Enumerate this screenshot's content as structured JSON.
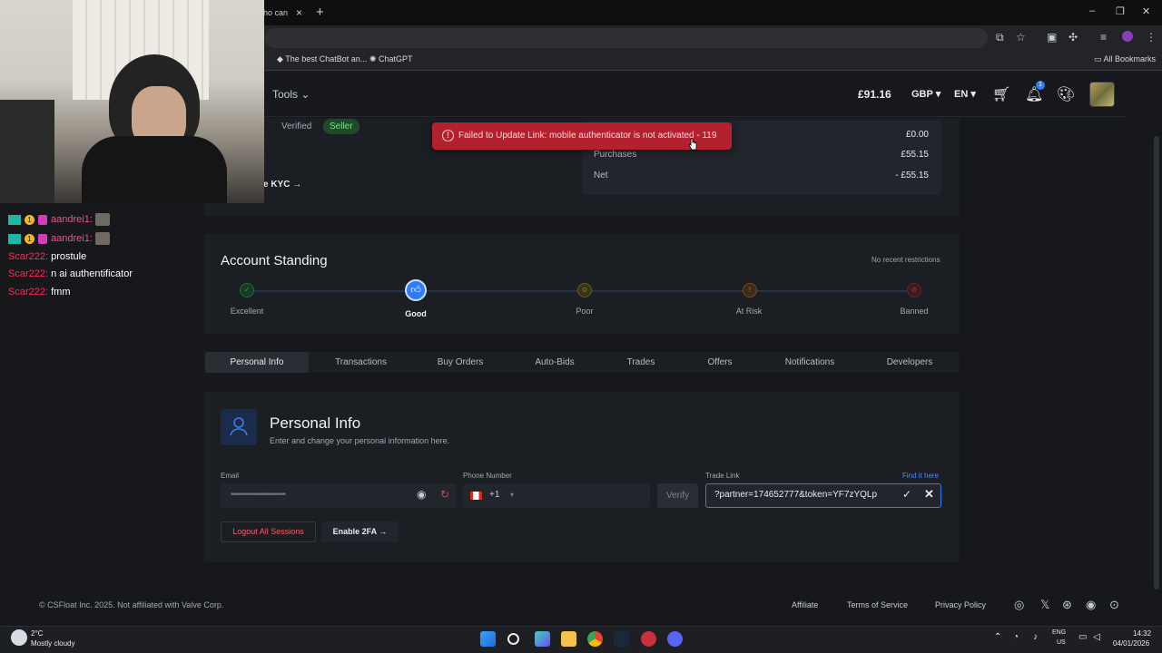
{
  "browser": {
    "tab_title": "ho can",
    "tab_close": "×",
    "new_tab": "+",
    "bookmarks": [
      "The best ChatBot an...",
      "ChatGPT"
    ],
    "all_bookmarks": "All Bookmarks",
    "window_controls": [
      "–",
      "❐",
      "✕"
    ]
  },
  "header": {
    "tools": "Tools",
    "balance": "£91.16",
    "currency": "GBP",
    "language": "EN",
    "notification_count": "1"
  },
  "top": {
    "verified": "Verified",
    "seller": "Seller",
    "kyc": "e KYC",
    "stats": [
      {
        "label": "",
        "value": "£0.00"
      },
      {
        "label": "Purchases",
        "value": "£55.15"
      },
      {
        "label": "Net",
        "value": "- £55.15"
      }
    ]
  },
  "toast": {
    "message": "Failed to Update Link: mobile authenticator is not activated - 119",
    "color": "#b3202e"
  },
  "standing": {
    "title": "Account Standing",
    "note": "No recent restrictions",
    "levels": [
      "Excellent",
      "Good",
      "Poor",
      "At Risk",
      "Banned"
    ],
    "current": "Good"
  },
  "tabs": [
    "Personal Info",
    "Transactions",
    "Buy Orders",
    "Auto-Bids",
    "Trades",
    "Offers",
    "Notifications",
    "Developers"
  ],
  "personal_info": {
    "title": "Personal Info",
    "subtitle": "Enter and change your personal information here.",
    "email_label": "Email",
    "email_value": "••••••••••••••••••••••••",
    "phone_label": "Phone Number",
    "dial_code": "+1",
    "verify": "Verify",
    "trade_label": "Trade Link",
    "find_it": "Find it here",
    "trade_value": "?partner=174652777&token=YF7zYQLp",
    "logout": "Logout All Sessions",
    "enable_2fa": "Enable 2FA"
  },
  "footer": {
    "copyright": "© CSFloat Inc. 2025. Not affiliated with Valve Corp.",
    "links": [
      "Affiliate",
      "Terms of Service",
      "Privacy Policy"
    ]
  },
  "chat": [
    {
      "user": "aandrei1:",
      "msg": "",
      "badges": true
    },
    {
      "user": "aandrei1:",
      "msg": "",
      "badges": true
    },
    {
      "user": "Scar222:",
      "msg": "prostule",
      "badges": false
    },
    {
      "user": "Scar222:",
      "msg": "n ai authentificator",
      "badges": false
    },
    {
      "user": "Scar222:",
      "msg": "fmm",
      "badges": false
    }
  ],
  "taskbar": {
    "weather_temp": "2°C",
    "weather_desc": "Mostly cloudy",
    "lang1": "ENG",
    "lang2": "US",
    "time": "14:32",
    "date": "04/01/2026"
  }
}
